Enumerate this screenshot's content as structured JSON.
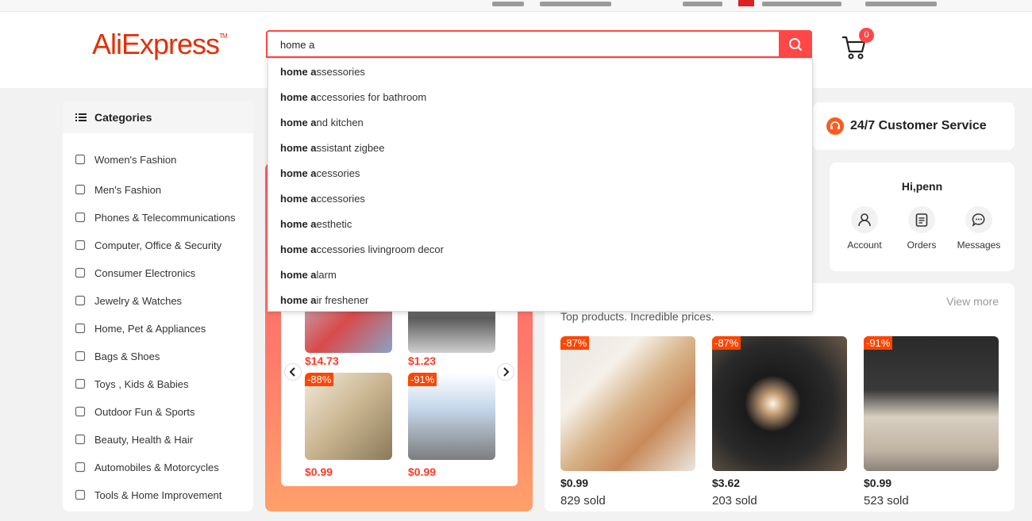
{
  "header": {
    "logo_text": "AliExpress",
    "logo_tm": "TM",
    "search_value": "home a",
    "cart_count": "0"
  },
  "suggestions": {
    "prefix": "home a",
    "items": [
      {
        "bold": "home a",
        "rest": "ssessories"
      },
      {
        "bold": "home a",
        "rest": "ccessories for bathroom"
      },
      {
        "bold": "home a",
        "rest": "nd kitchen"
      },
      {
        "bold": "home a",
        "rest": "ssistant zigbee"
      },
      {
        "bold": "home a",
        "rest": "cessories"
      },
      {
        "bold": "home a",
        "rest": "ccessories"
      },
      {
        "bold": "home a",
        "rest": "esthetic"
      },
      {
        "bold": "home a",
        "rest": "ccessories livingroom decor"
      },
      {
        "bold": "home a",
        "rest": "larm"
      },
      {
        "bold": "home a",
        "rest": "ir freshener"
      }
    ]
  },
  "categories": {
    "title": "Categories",
    "items": [
      {
        "label": "Women's Fashion",
        "icon": "dress-icon"
      },
      {
        "label": "Men's Fashion",
        "icon": "shirt-icon"
      },
      {
        "label": "Phones & Telecommunications",
        "icon": "phone-icon"
      },
      {
        "label": "Computer, Office & Security",
        "icon": "laptop-icon"
      },
      {
        "label": "Consumer Electronics",
        "icon": "camera-icon"
      },
      {
        "label": "Jewelry & Watches",
        "icon": "ring-icon"
      },
      {
        "label": "Home, Pet & Appliances",
        "icon": "sofa-icon"
      },
      {
        "label": "Bags & Shoes",
        "icon": "bag-icon"
      },
      {
        "label": "Toys , Kids & Babies",
        "icon": "bottle-icon"
      },
      {
        "label": "Outdoor Fun & Sports",
        "icon": "ball-icon"
      },
      {
        "label": "Beauty, Health & Hair",
        "icon": "lipstick-icon"
      },
      {
        "label": "Automobiles & Motorcycles",
        "icon": "wheel-icon"
      },
      {
        "label": "Tools & Home Improvement",
        "icon": "tools-icon"
      }
    ]
  },
  "promo": {
    "products": [
      {
        "price": "$14.73",
        "discount": ""
      },
      {
        "price": "$1.23",
        "discount": ""
      },
      {
        "price": "$0.99",
        "discount": "-88%"
      },
      {
        "price": "$0.99",
        "discount": "-91%"
      }
    ]
  },
  "customer_service": {
    "label": "24/7 Customer Service"
  },
  "user": {
    "greeting": "Hi,penn",
    "actions": [
      {
        "label": "Account",
        "icon": "account-icon"
      },
      {
        "label": "Orders",
        "icon": "orders-icon"
      },
      {
        "label": "Messages",
        "icon": "messages-icon"
      }
    ]
  },
  "deals": {
    "subtitle": "Top products. Incredible prices.",
    "view_more": "View more",
    "products": [
      {
        "discount": "-87%",
        "price": "$0.99",
        "sold": "829 sold"
      },
      {
        "discount": "-87%",
        "price": "$3.62",
        "sold": "203 sold"
      },
      {
        "discount": "-91%",
        "price": "$0.99",
        "sold": "523 sold"
      }
    ]
  },
  "colors": {
    "accent": "#ff4747",
    "brand": "#e62e04",
    "discount": "#ff4500"
  }
}
